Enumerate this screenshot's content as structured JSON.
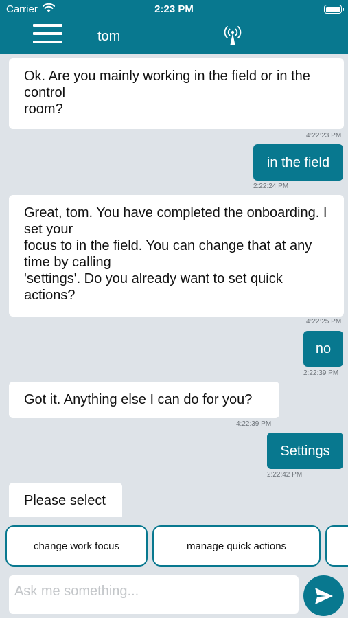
{
  "status_bar": {
    "carrier": "Carrier",
    "time": "2:23 PM"
  },
  "header": {
    "title": "tom",
    "menu_icon": "hamburger-menu-icon",
    "connection_icon": "antenna-signal-icon"
  },
  "messages": [
    {
      "sender": "bot",
      "text": "Ok. Are you mainly working in the field or in the control\nroom?",
      "time": "4:22:23 PM"
    },
    {
      "sender": "user",
      "text": "in the field",
      "time": "2:22:24 PM"
    },
    {
      "sender": "bot",
      "text": "Great, tom. You have completed the onboarding. I set your\nfocus to in the field. You can change that at any time by calling\n'settings'. Do you already want to set quick actions?",
      "time": "4:22:25 PM"
    },
    {
      "sender": "user",
      "text": "no",
      "time": "2:22:39 PM"
    },
    {
      "sender": "bot",
      "text": "Got it. Anything else I can do for you?",
      "time": "4:22:39 PM"
    },
    {
      "sender": "user",
      "text": "Settings",
      "time": "2:22:42 PM"
    },
    {
      "sender": "bot",
      "text": "Please select",
      "time": ""
    }
  ],
  "quick_replies": [
    "change work focus",
    "manage quick actions",
    ""
  ],
  "composer": {
    "placeholder": "Ask me something...",
    "send_icon": "send-arrow-icon"
  },
  "colors": {
    "accent": "#08788f",
    "background": "#dee3e8",
    "bubble": "#ffffff"
  }
}
